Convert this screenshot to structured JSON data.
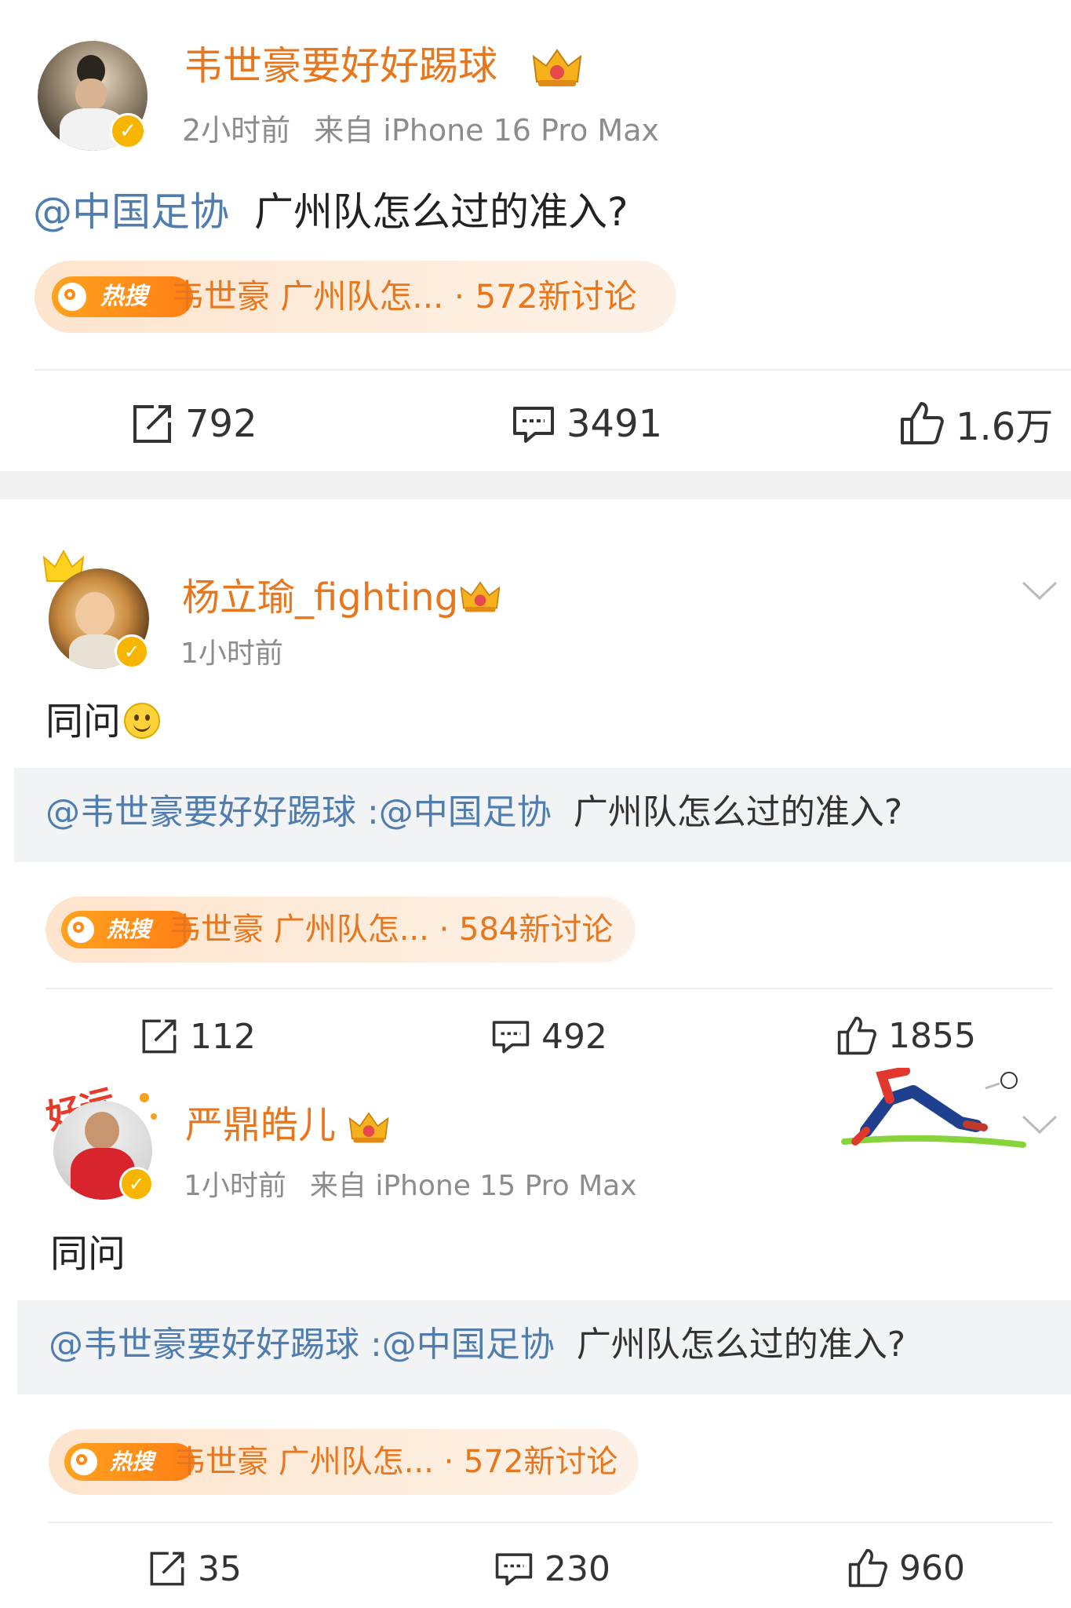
{
  "posts": [
    {
      "username": "韦世豪要好好踢球",
      "time": "2小时前",
      "source": "来自 iPhone 16 Pro Max",
      "mention": "@中国足协",
      "text": "广州队怎么过的准入?",
      "hot_label": "热搜",
      "hot_text": "韦世豪 广州队怎... · 572新讨论",
      "reposts": "792",
      "comments": "3491",
      "likes": "1.6万"
    },
    {
      "username": "杨立瑜_fighting",
      "time": "1小时前",
      "text": "同问",
      "quote_mention": "@韦世豪要好好踢球 :@中国足协",
      "quote_text": "广州队怎么过的准入?",
      "hot_label": "热搜",
      "hot_text": "韦世豪 广州队怎... · 584新讨论",
      "reposts": "112",
      "comments": "492",
      "likes": "1855"
    },
    {
      "username": "严鼎皓儿",
      "time": "1小时前",
      "source": "来自 iPhone 15 Pro Max",
      "text": "同问",
      "quote_mention": "@韦世豪要好好踢球 :@中国足协",
      "quote_text": "广州队怎么过的准入?",
      "hot_label": "热搜",
      "hot_text": "韦世豪 广州队怎... · 572新讨论",
      "reposts": "35",
      "comments": "230",
      "likes": "960"
    }
  ],
  "colors": {
    "username": "#e8761c",
    "mention": "#507daf",
    "meta": "#8c8c8c",
    "verified": "#f7b500",
    "hot_orange": "#ff8a17"
  }
}
